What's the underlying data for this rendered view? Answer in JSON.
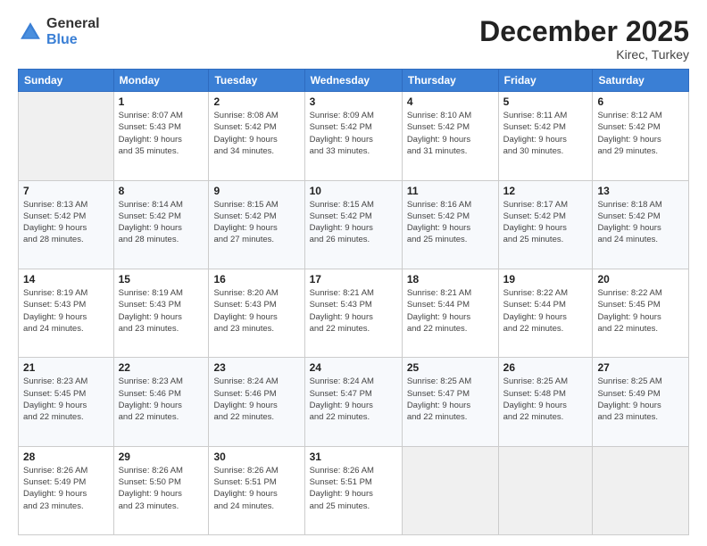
{
  "logo": {
    "general": "General",
    "blue": "Blue"
  },
  "header": {
    "month": "December 2025",
    "location": "Kirec, Turkey"
  },
  "weekdays": [
    "Sunday",
    "Monday",
    "Tuesday",
    "Wednesday",
    "Thursday",
    "Friday",
    "Saturday"
  ],
  "weeks": [
    [
      {
        "day": "",
        "info": ""
      },
      {
        "day": "1",
        "info": "Sunrise: 8:07 AM\nSunset: 5:43 PM\nDaylight: 9 hours\nand 35 minutes."
      },
      {
        "day": "2",
        "info": "Sunrise: 8:08 AM\nSunset: 5:42 PM\nDaylight: 9 hours\nand 34 minutes."
      },
      {
        "day": "3",
        "info": "Sunrise: 8:09 AM\nSunset: 5:42 PM\nDaylight: 9 hours\nand 33 minutes."
      },
      {
        "day": "4",
        "info": "Sunrise: 8:10 AM\nSunset: 5:42 PM\nDaylight: 9 hours\nand 31 minutes."
      },
      {
        "day": "5",
        "info": "Sunrise: 8:11 AM\nSunset: 5:42 PM\nDaylight: 9 hours\nand 30 minutes."
      },
      {
        "day": "6",
        "info": "Sunrise: 8:12 AM\nSunset: 5:42 PM\nDaylight: 9 hours\nand 29 minutes."
      }
    ],
    [
      {
        "day": "7",
        "info": "Sunrise: 8:13 AM\nSunset: 5:42 PM\nDaylight: 9 hours\nand 28 minutes."
      },
      {
        "day": "8",
        "info": "Sunrise: 8:14 AM\nSunset: 5:42 PM\nDaylight: 9 hours\nand 28 minutes."
      },
      {
        "day": "9",
        "info": "Sunrise: 8:15 AM\nSunset: 5:42 PM\nDaylight: 9 hours\nand 27 minutes."
      },
      {
        "day": "10",
        "info": "Sunrise: 8:15 AM\nSunset: 5:42 PM\nDaylight: 9 hours\nand 26 minutes."
      },
      {
        "day": "11",
        "info": "Sunrise: 8:16 AM\nSunset: 5:42 PM\nDaylight: 9 hours\nand 25 minutes."
      },
      {
        "day": "12",
        "info": "Sunrise: 8:17 AM\nSunset: 5:42 PM\nDaylight: 9 hours\nand 25 minutes."
      },
      {
        "day": "13",
        "info": "Sunrise: 8:18 AM\nSunset: 5:42 PM\nDaylight: 9 hours\nand 24 minutes."
      }
    ],
    [
      {
        "day": "14",
        "info": "Sunrise: 8:19 AM\nSunset: 5:43 PM\nDaylight: 9 hours\nand 24 minutes."
      },
      {
        "day": "15",
        "info": "Sunrise: 8:19 AM\nSunset: 5:43 PM\nDaylight: 9 hours\nand 23 minutes."
      },
      {
        "day": "16",
        "info": "Sunrise: 8:20 AM\nSunset: 5:43 PM\nDaylight: 9 hours\nand 23 minutes."
      },
      {
        "day": "17",
        "info": "Sunrise: 8:21 AM\nSunset: 5:43 PM\nDaylight: 9 hours\nand 22 minutes."
      },
      {
        "day": "18",
        "info": "Sunrise: 8:21 AM\nSunset: 5:44 PM\nDaylight: 9 hours\nand 22 minutes."
      },
      {
        "day": "19",
        "info": "Sunrise: 8:22 AM\nSunset: 5:44 PM\nDaylight: 9 hours\nand 22 minutes."
      },
      {
        "day": "20",
        "info": "Sunrise: 8:22 AM\nSunset: 5:45 PM\nDaylight: 9 hours\nand 22 minutes."
      }
    ],
    [
      {
        "day": "21",
        "info": "Sunrise: 8:23 AM\nSunset: 5:45 PM\nDaylight: 9 hours\nand 22 minutes."
      },
      {
        "day": "22",
        "info": "Sunrise: 8:23 AM\nSunset: 5:46 PM\nDaylight: 9 hours\nand 22 minutes."
      },
      {
        "day": "23",
        "info": "Sunrise: 8:24 AM\nSunset: 5:46 PM\nDaylight: 9 hours\nand 22 minutes."
      },
      {
        "day": "24",
        "info": "Sunrise: 8:24 AM\nSunset: 5:47 PM\nDaylight: 9 hours\nand 22 minutes."
      },
      {
        "day": "25",
        "info": "Sunrise: 8:25 AM\nSunset: 5:47 PM\nDaylight: 9 hours\nand 22 minutes."
      },
      {
        "day": "26",
        "info": "Sunrise: 8:25 AM\nSunset: 5:48 PM\nDaylight: 9 hours\nand 22 minutes."
      },
      {
        "day": "27",
        "info": "Sunrise: 8:25 AM\nSunset: 5:49 PM\nDaylight: 9 hours\nand 23 minutes."
      }
    ],
    [
      {
        "day": "28",
        "info": "Sunrise: 8:26 AM\nSunset: 5:49 PM\nDaylight: 9 hours\nand 23 minutes."
      },
      {
        "day": "29",
        "info": "Sunrise: 8:26 AM\nSunset: 5:50 PM\nDaylight: 9 hours\nand 23 minutes."
      },
      {
        "day": "30",
        "info": "Sunrise: 8:26 AM\nSunset: 5:51 PM\nDaylight: 9 hours\nand 24 minutes."
      },
      {
        "day": "31",
        "info": "Sunrise: 8:26 AM\nSunset: 5:51 PM\nDaylight: 9 hours\nand 25 minutes."
      },
      {
        "day": "",
        "info": ""
      },
      {
        "day": "",
        "info": ""
      },
      {
        "day": "",
        "info": ""
      }
    ]
  ]
}
